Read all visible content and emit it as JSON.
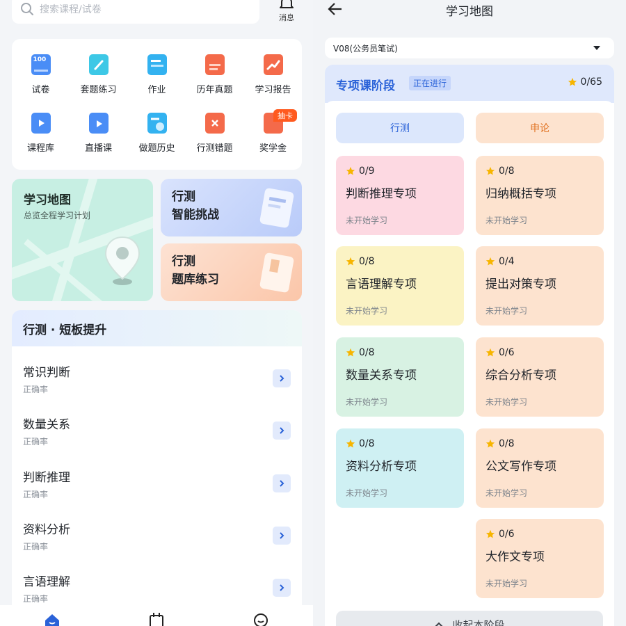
{
  "left": {
    "search": {
      "placeholder": "搜索课程/试卷"
    },
    "message_label": "消息",
    "grid": [
      {
        "label": "试卷",
        "icon": "exam-paper-icon",
        "color": "#4a8df6",
        "badge": "100"
      },
      {
        "label": "套题练习",
        "icon": "pencil-book-icon",
        "color": "#3dc8e6"
      },
      {
        "label": "作业",
        "icon": "homework-icon",
        "color": "#33b2f0"
      },
      {
        "label": "历年真题",
        "icon": "past-papers-icon",
        "color": "#f46a4a"
      },
      {
        "label": "学习报告",
        "icon": "report-chart-icon",
        "color": "#f46a4a"
      },
      {
        "label": "课程库",
        "icon": "video-library-icon",
        "color": "#4a8df6"
      },
      {
        "label": "直播课",
        "icon": "live-class-icon",
        "color": "#4a8df6"
      },
      {
        "label": "做题历史",
        "icon": "history-clock-icon",
        "color": "#33b2f0"
      },
      {
        "label": "行测错题",
        "icon": "wrong-answers-icon",
        "color": "#f46a4a"
      },
      {
        "label": "奖学金",
        "icon": "scholarship-icon",
        "color": "#f46a4a"
      }
    ],
    "grid_badge": "抽卡",
    "map_card": {
      "title": "学习地图",
      "subtitle": "总览全程学习计划"
    },
    "challenge_card": {
      "line1": "行测",
      "line2": "智能挑战"
    },
    "bank_card": {
      "line1": "行测",
      "line2": "题库练习"
    },
    "weak": {
      "title": "行测 · 短板提升",
      "items": [
        {
          "title": "常识判断",
          "sub": "正确率"
        },
        {
          "title": "数量关系",
          "sub": "正确率"
        },
        {
          "title": "判断推理",
          "sub": "正确率"
        },
        {
          "title": "资料分析",
          "sub": "正确率"
        },
        {
          "title": "言语理解",
          "sub": "正确率"
        }
      ]
    }
  },
  "right": {
    "title": "学习地图",
    "version": "V08(公务员笔试)",
    "stage": {
      "title": "专项课阶段",
      "status": "正在进行",
      "score": "0/65"
    },
    "columns": {
      "xingce": "行测",
      "shenlun": "申论"
    },
    "xingce_modules": [
      {
        "score": "0/9",
        "title": "判断推理专项",
        "status": "未开始学习",
        "color": "#fdd9e2"
      },
      {
        "score": "0/8",
        "title": "言语理解专项",
        "status": "未开始学习",
        "color": "#fbf3c4"
      },
      {
        "score": "0/8",
        "title": "数量关系专项",
        "status": "未开始学习",
        "color": "#d8f2e3"
      },
      {
        "score": "0/8",
        "title": "资料分析专项",
        "status": "未开始学习",
        "color": "#cff0f3"
      }
    ],
    "shenlun_modules": [
      {
        "score": "0/8",
        "title": "归纳概括专项",
        "status": "未开始学习",
        "color": "#fde3cf"
      },
      {
        "score": "0/4",
        "title": "提出对策专项",
        "status": "未开始学习",
        "color": "#fde3cf"
      },
      {
        "score": "0/6",
        "title": "综合分析专项",
        "status": "未开始学习",
        "color": "#fde3cf"
      },
      {
        "score": "0/8",
        "title": "公文写作专项",
        "status": "未开始学习",
        "color": "#fde3cf"
      },
      {
        "score": "0/6",
        "title": "大作文专项",
        "status": "未开始学习",
        "color": "#fde3cf"
      }
    ],
    "collapse_label": "收起本阶段"
  }
}
